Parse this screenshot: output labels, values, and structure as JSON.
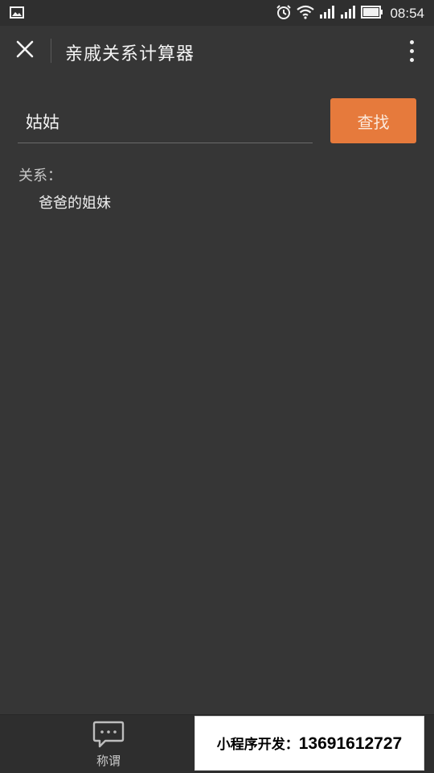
{
  "status_bar": {
    "time": "08:54",
    "icons": [
      "image-notification-icon",
      "alarm-icon",
      "wifi-icon",
      "signal-icon",
      "signal-icon",
      "battery-icon"
    ]
  },
  "header": {
    "title": "亲戚关系计算器",
    "close_icon": "close-icon",
    "more_icon": "more-vertical-icon"
  },
  "search": {
    "value": "姑姑",
    "button_label": "查找"
  },
  "result": {
    "label": "关系：",
    "value": "爸爸的姐妹"
  },
  "tab_bar": {
    "items": [
      {
        "label": "称谓",
        "icon": "chat-bubble-icon"
      }
    ]
  },
  "ad_overlay": {
    "label": "小程序开发：",
    "phone": "13691612727"
  },
  "colors": {
    "background": "#363636",
    "accent": "#e67a3c"
  }
}
